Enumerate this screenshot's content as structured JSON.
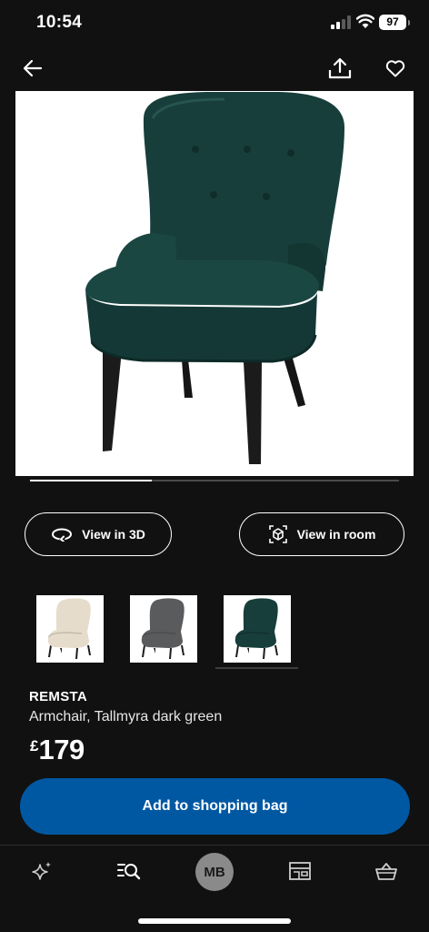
{
  "status_bar": {
    "time": "10:54",
    "battery": "97"
  },
  "top_bar": {
    "back_icon": "arrow-left-icon",
    "share_icon": "share-icon",
    "favourite_icon": "heart-icon"
  },
  "gallery": {
    "progress": 0.33,
    "image_icon": "armchair-photo"
  },
  "actions": {
    "view_3d": "View in 3D",
    "view_room": "View in room"
  },
  "variants": [
    {
      "name": "beige",
      "color": "#e6dccb"
    },
    {
      "name": "grey",
      "color": "#5a5b5d"
    },
    {
      "name": "dark green",
      "color": "#173e3b",
      "selected": true
    }
  ],
  "product": {
    "name": "REMSTA",
    "description": "Armchair, Tallmyra dark green",
    "currency": "£",
    "price": "179"
  },
  "cta": {
    "label": "Add to shopping bag",
    "color": "#0058a3"
  },
  "bottom_nav": {
    "items": [
      "sparkle-icon",
      "search-list-icon",
      "avatar",
      "store-icon",
      "basket-icon"
    ],
    "avatar_initials": "MB"
  },
  "colors": {
    "background": "#111111",
    "chair": "#173e3b",
    "accent": "#0058a3"
  }
}
